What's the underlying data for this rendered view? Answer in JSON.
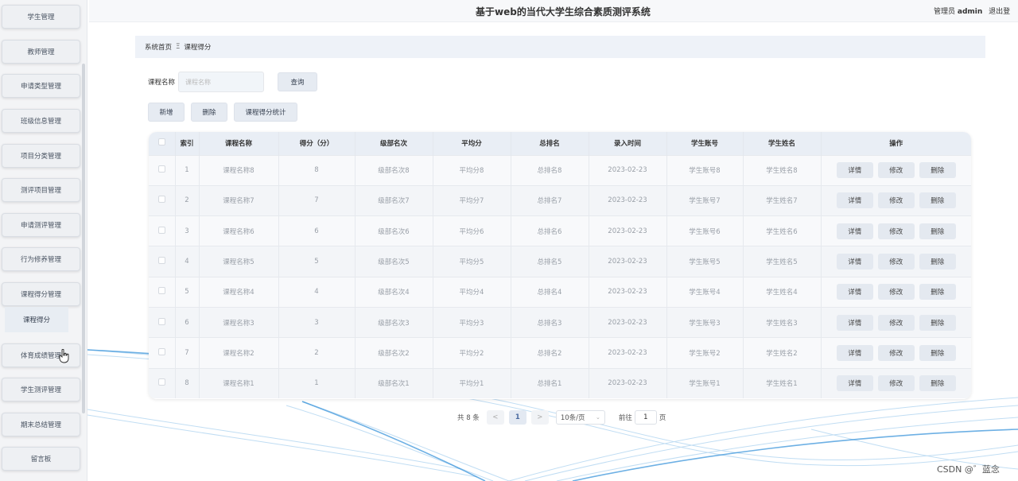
{
  "header": {
    "title": "基于web的当代大学生综合素质测评系统",
    "user_label": "管理员",
    "user_name": "admin",
    "logout": "退出登"
  },
  "sidebar": {
    "items": [
      {
        "label": "学生管理"
      },
      {
        "label": "教师管理"
      },
      {
        "label": "申请类型管理"
      },
      {
        "label": "班级信息管理"
      },
      {
        "label": "项目分类管理"
      },
      {
        "label": "测评项目管理"
      },
      {
        "label": "申请测评管理"
      },
      {
        "label": "行为修养管理"
      },
      {
        "label": "课程得分管理"
      },
      {
        "label": "体育成绩管理"
      },
      {
        "label": "学生测评管理"
      },
      {
        "label": "期末总结管理"
      },
      {
        "label": "留言板"
      }
    ],
    "submenu_label": "课程得分"
  },
  "breadcrumb": {
    "home": "系统首页",
    "separator": "Ξ",
    "current": "课程得分"
  },
  "search": {
    "label": "课程名称",
    "placeholder": "课程名称",
    "button": "查询"
  },
  "actions": {
    "add": "新增",
    "delete": "删除",
    "stats": "课程得分统计"
  },
  "table": {
    "headers": [
      "索引",
      "课程名称",
      "得分（分）",
      "级部名次",
      "平均分",
      "总排名",
      "录入时间",
      "学生账号",
      "学生姓名",
      "操作"
    ],
    "operations": {
      "detail": "详情",
      "edit": "修改",
      "delete": "删除"
    },
    "rows": [
      {
        "index": "1",
        "course": "课程名称8",
        "score": "8",
        "rank": "级部名次8",
        "avg": "平均分8",
        "total_rank": "总排名8",
        "time": "2023-02-23",
        "account": "学生账号8",
        "student": "学生姓名8"
      },
      {
        "index": "2",
        "course": "课程名称7",
        "score": "7",
        "rank": "级部名次7",
        "avg": "平均分7",
        "total_rank": "总排名7",
        "time": "2023-02-23",
        "account": "学生账号7",
        "student": "学生姓名7"
      },
      {
        "index": "3",
        "course": "课程名称6",
        "score": "6",
        "rank": "级部名次6",
        "avg": "平均分6",
        "total_rank": "总排名6",
        "time": "2023-02-23",
        "account": "学生账号6",
        "student": "学生姓名6"
      },
      {
        "index": "4",
        "course": "课程名称5",
        "score": "5",
        "rank": "级部名次5",
        "avg": "平均分5",
        "total_rank": "总排名5",
        "time": "2023-02-23",
        "account": "学生账号5",
        "student": "学生姓名5"
      },
      {
        "index": "5",
        "course": "课程名称4",
        "score": "4",
        "rank": "级部名次4",
        "avg": "平均分4",
        "total_rank": "总排名4",
        "time": "2023-02-23",
        "account": "学生账号4",
        "student": "学生姓名4"
      },
      {
        "index": "6",
        "course": "课程名称3",
        "score": "3",
        "rank": "级部名次3",
        "avg": "平均分3",
        "total_rank": "总排名3",
        "time": "2023-02-23",
        "account": "学生账号3",
        "student": "学生姓名3"
      },
      {
        "index": "7",
        "course": "课程名称2",
        "score": "2",
        "rank": "级部名次2",
        "avg": "平均分2",
        "total_rank": "总排名2",
        "time": "2023-02-23",
        "account": "学生账号2",
        "student": "学生姓名2"
      },
      {
        "index": "8",
        "course": "课程名称1",
        "score": "1",
        "rank": "级部名次1",
        "avg": "平均分1",
        "total_rank": "总排名1",
        "time": "2023-02-23",
        "account": "学生账号1",
        "student": "学生姓名1"
      }
    ]
  },
  "pagination": {
    "total": "共 8 条",
    "prev": "<",
    "page": "1",
    "next": ">",
    "page_size": "10条/页",
    "goto_prefix": "前往",
    "goto_value": "1",
    "goto_suffix": "页"
  },
  "watermark": "CSDN @゛蓝念",
  "colors": {
    "accent": "#4a6aa0",
    "wave": "#7fb6e0"
  }
}
